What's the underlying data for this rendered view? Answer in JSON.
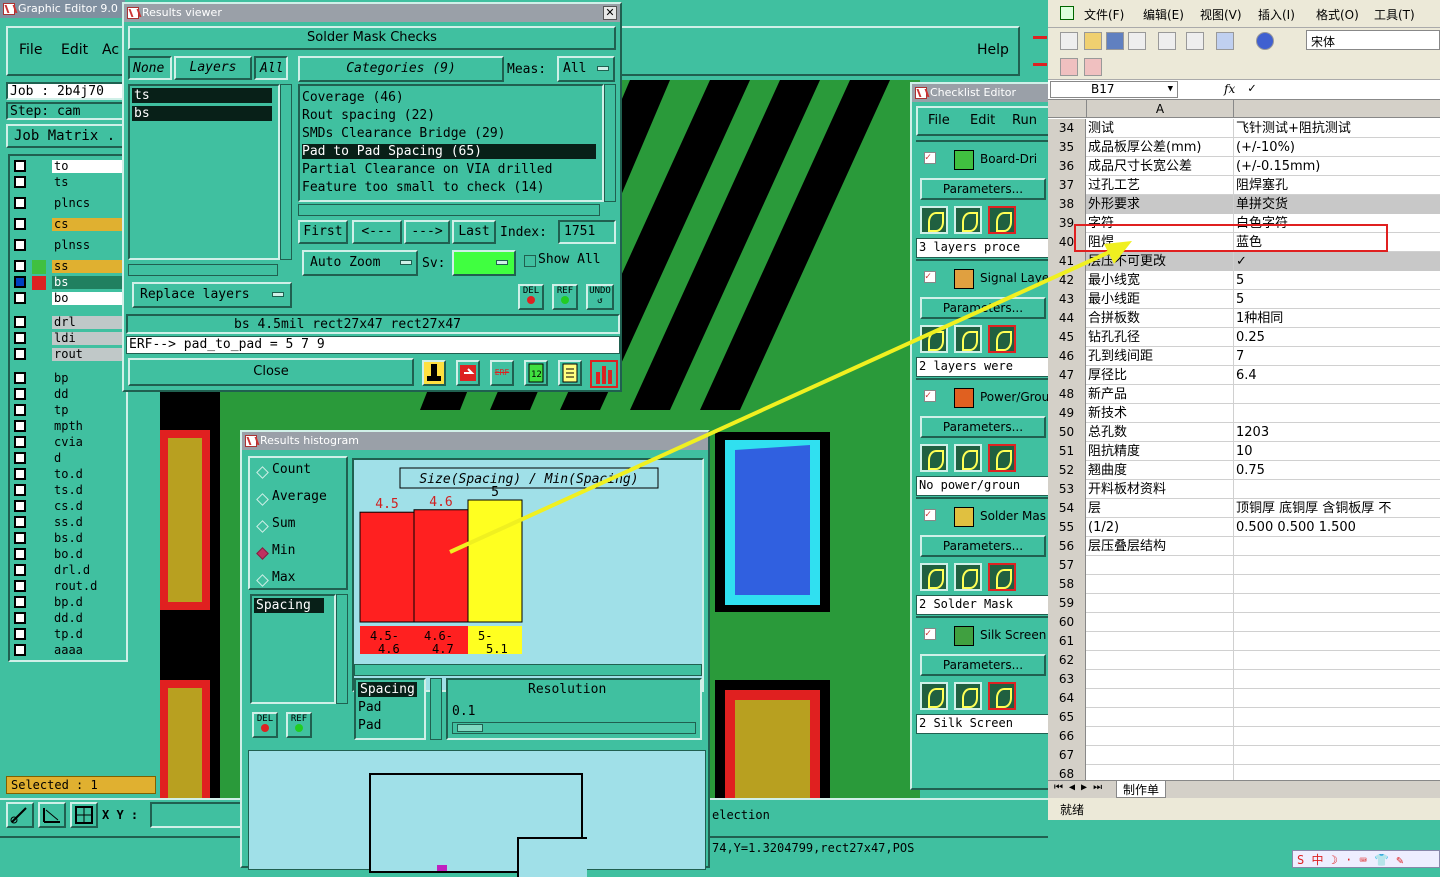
{
  "graphic_editor": {
    "title": "Graphic Editor 9.0",
    "menu": [
      "File",
      "Edit",
      "Ac"
    ],
    "help": "Help",
    "job_label": "Job : 2b4j70",
    "step_label": "Step: cam",
    "job_matrix": "Job Matrix .",
    "layers": [
      "to",
      "ts",
      "plncs",
      "cs",
      "plnss",
      "ss",
      "bs",
      "bo",
      "drl",
      "ldi",
      "rout",
      "bp",
      "dd",
      "tp",
      "mpth",
      "cvia",
      "d",
      "to.d",
      "ts.d",
      "cs.d",
      "ss.d",
      "bs.d",
      "bo.d",
      "drl.d",
      "rout.d",
      "bp.d",
      "dd.d",
      "tp.d",
      "aaaa"
    ],
    "selected": "Selected : 1",
    "xy_label": "X Y :",
    "status_text": "election",
    "coord_text": "74,Y=1.3204799,rect27x47,POS"
  },
  "results_viewer": {
    "title": "Results viewer",
    "header": "Solder Mask Checks",
    "none_btn": "None",
    "layers_btn": "Layers",
    "all_btn": "All",
    "categories_btn": "Categories (9)",
    "meas_label": "Meas:",
    "meas_value": "All",
    "layer_items": [
      "ts",
      "bs"
    ],
    "categories": [
      "Coverage (46)",
      "Rout spacing (22)",
      "SMDs Clearance Bridge (29)",
      "Pad to Pad Spacing (65)",
      "Partial Clearance on VIA drilled",
      "Feature too small to check (14)"
    ],
    "first": "First",
    "prev": "<---",
    "next": "--->",
    "last": "Last",
    "index_label": "Index:",
    "index_value": "1751",
    "auto_zoom": "Auto Zoom",
    "sv_label": "Sv:",
    "show_all": "Show All",
    "replace_layers": "Replace layers",
    "del": "DEL",
    "ref": "REF",
    "undo": "UNDO",
    "info": "bs 4.5mil   rect27x47   rect27x47",
    "erf": "ERF--> pad_to_pad = 5 7 9",
    "close": "Close"
  },
  "histogram": {
    "title": "Results histogram",
    "options": [
      "Count",
      "Average",
      "Sum",
      "Min",
      "Max"
    ],
    "selected_option": "Min",
    "list_item": "Spacing",
    "del": "DEL",
    "ref": "REF",
    "chart_title": "Size(Spacing) / Min(Spacing)",
    "list2": [
      "Spacing",
      "Pad",
      "Pad"
    ],
    "resolution_label": "Resolution",
    "resolution_value": "0.1"
  },
  "chart_data": {
    "type": "bar",
    "title": "Size(Spacing) / Min(Spacing)",
    "categories": [
      "4.5-4.6",
      "4.6-4.7",
      "5-5.1"
    ],
    "category_lines": [
      [
        "4.5-",
        "4.6"
      ],
      [
        "4.6-",
        "4.7"
      ],
      [
        "5-",
        "5.1"
      ]
    ],
    "values": [
      4.5,
      4.6,
      5
    ],
    "value_labels": [
      "4.5",
      "4.6",
      "5"
    ],
    "colors": [
      "#ff2020",
      "#ff2020",
      "#ffff20"
    ],
    "ylim": [
      0,
      5
    ]
  },
  "checklist": {
    "title": "Checklist Editor",
    "menu": [
      "File",
      "Edit",
      "Run"
    ],
    "params_label": "Parameters...",
    "items": [
      {
        "name": "Board-Dri",
        "status": "3 layers proce"
      },
      {
        "name": "Signal Laye",
        "status": "2 layers were"
      },
      {
        "name": "Power/Grou",
        "status": "No power/groun"
      },
      {
        "name": "Solder Mas",
        "status": "2 Solder Mask"
      },
      {
        "name": "Silk Screen",
        "status": "2 Silk Screen"
      }
    ]
  },
  "excel": {
    "menu": [
      "文件(F)",
      "编辑(E)",
      "视图(V)",
      "插入(I)",
      "格式(O)",
      "工具(T)"
    ],
    "font": "宋体",
    "cell_ref": "B17",
    "fx": "fx",
    "formula": "✓",
    "col_a": "A",
    "rows": [
      {
        "n": "34",
        "a": "测试",
        "b": "飞针测试+阻抗测试"
      },
      {
        "n": "35",
        "a": "成品板厚公差(mm)",
        "b": "(+/-10%)"
      },
      {
        "n": "36",
        "a": "成品尺寸长宽公差",
        "b": "(+/-0.15mm)"
      },
      {
        "n": "37",
        "a": "过孔工艺",
        "b": "阻焊塞孔"
      },
      {
        "n": "38",
        "a": "外形要求",
        "b": "单拼交货"
      },
      {
        "n": "39",
        "a": "字符",
        "b": "白色字符"
      },
      {
        "n": "40",
        "a": "阻焊",
        "b": "蓝色"
      },
      {
        "n": "41",
        "a": "层压不可更改",
        "b": "✓"
      },
      {
        "n": "42",
        "a": "最小线宽",
        "b": "5"
      },
      {
        "n": "43",
        "a": "最小线距",
        "b": "5"
      },
      {
        "n": "44",
        "a": "合拼板数",
        "b": "1种相同"
      },
      {
        "n": "45",
        "a": "钻孔孔径",
        "b": "0.25"
      },
      {
        "n": "46",
        "a": "孔到线间距",
        "b": "7"
      },
      {
        "n": "47",
        "a": "厚径比",
        "b": "6.4"
      },
      {
        "n": "48",
        "a": "新产品",
        "b": ""
      },
      {
        "n": "49",
        "a": "新技术",
        "b": ""
      },
      {
        "n": "50",
        "a": "总孔数",
        "b": "1203"
      },
      {
        "n": "51",
        "a": "阻抗精度",
        "b": "10"
      },
      {
        "n": "52",
        "a": "翘曲度",
        "b": "0.75"
      },
      {
        "n": "53",
        "a": "开料板材资料",
        "b": ""
      },
      {
        "n": "54",
        "a": "层",
        "b": "顶铜厚 底铜厚 含铜板厚 不"
      },
      {
        "n": "55",
        "a": "(1/2)",
        "b": "0.500  0.500   1.500"
      },
      {
        "n": "56",
        "a": "层压叠层结构",
        "b": ""
      },
      {
        "n": "57",
        "a": "",
        "b": ""
      },
      {
        "n": "58",
        "a": "",
        "b": ""
      },
      {
        "n": "59",
        "a": "",
        "b": ""
      },
      {
        "n": "60",
        "a": "",
        "b": ""
      },
      {
        "n": "61",
        "a": "",
        "b": ""
      },
      {
        "n": "62",
        "a": "",
        "b": ""
      },
      {
        "n": "63",
        "a": "",
        "b": ""
      },
      {
        "n": "64",
        "a": "",
        "b": ""
      },
      {
        "n": "65",
        "a": "",
        "b": ""
      },
      {
        "n": "66",
        "a": "",
        "b": ""
      },
      {
        "n": "67",
        "a": "",
        "b": ""
      },
      {
        "n": "68",
        "a": "",
        "b": ""
      }
    ],
    "sheet_tab": "制作单",
    "status": "就绪"
  }
}
